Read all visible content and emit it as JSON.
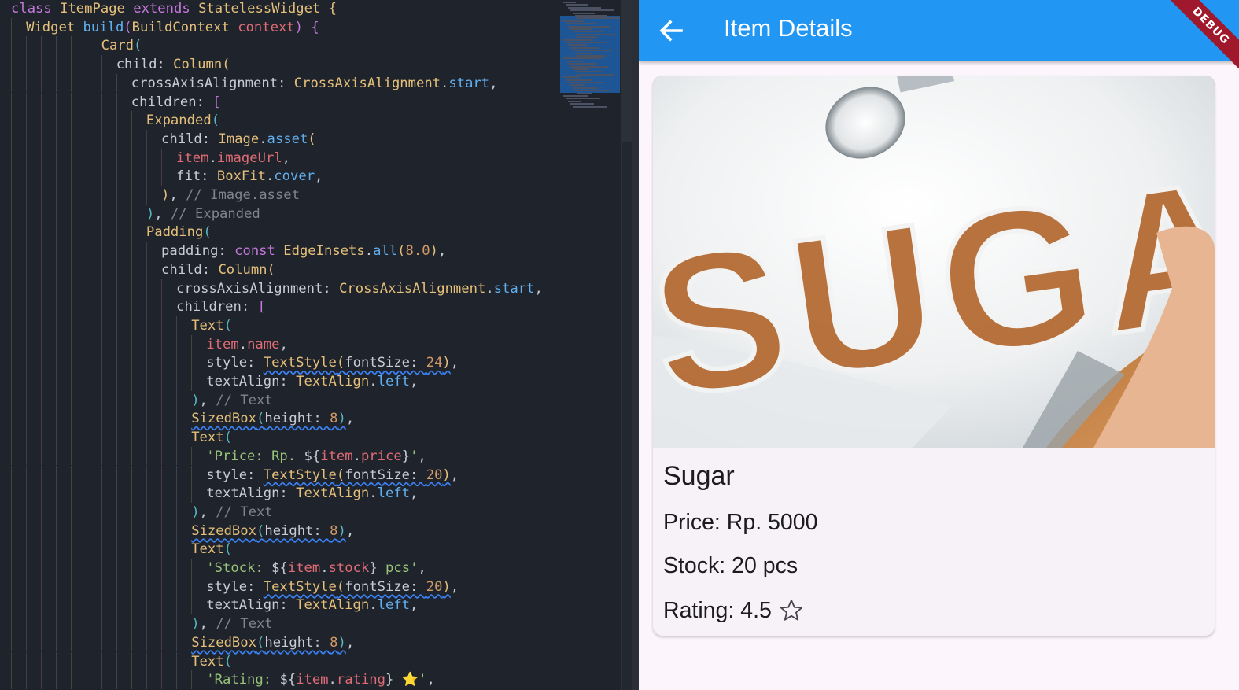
{
  "editor": {
    "lines": [
      {
        "indent": 0,
        "html_parts": [
          [
            "k",
            "class"
          ],
          [
            "p",
            " "
          ],
          [
            "t",
            "ItemPage"
          ],
          [
            "p",
            " "
          ],
          [
            "k",
            "extends"
          ],
          [
            "p",
            " "
          ],
          [
            "t",
            "StatelessWidget"
          ],
          [
            "p",
            " "
          ],
          [
            "b1",
            "{"
          ]
        ]
      },
      {
        "indent": 1,
        "html_parts": [
          [
            "t",
            "Widget"
          ],
          [
            "p",
            " "
          ],
          [
            "f",
            "build"
          ],
          [
            "b2",
            "("
          ],
          [
            "t",
            "BuildContext"
          ],
          [
            "p",
            " "
          ],
          [
            "v",
            "context"
          ],
          [
            "b2",
            ")"
          ],
          [
            "p",
            " "
          ],
          [
            "b2",
            "{"
          ]
        ]
      },
      {
        "indent": 6,
        "html_parts": [
          [
            "t",
            "Card"
          ],
          [
            "b3",
            "("
          ]
        ]
      },
      {
        "indent": 7,
        "html_parts": [
          [
            "p",
            "child: "
          ],
          [
            "t",
            "Column"
          ],
          [
            "b1",
            "("
          ]
        ]
      },
      {
        "indent": 8,
        "html_parts": [
          [
            "p",
            "crossAxisAlignment: "
          ],
          [
            "t",
            "CrossAxisAlignment"
          ],
          [
            "p",
            "."
          ],
          [
            "f",
            "start"
          ],
          [
            "p",
            ","
          ]
        ]
      },
      {
        "indent": 8,
        "html_parts": [
          [
            "p",
            "children: "
          ],
          [
            "b2",
            "["
          ]
        ]
      },
      {
        "indent": 9,
        "html_parts": [
          [
            "t",
            "Expanded"
          ],
          [
            "b3",
            "("
          ]
        ]
      },
      {
        "indent": 10,
        "html_parts": [
          [
            "p",
            "child: "
          ],
          [
            "t",
            "Image"
          ],
          [
            "p",
            "."
          ],
          [
            "f",
            "asset"
          ],
          [
            "b1",
            "("
          ]
        ]
      },
      {
        "indent": 11,
        "html_parts": [
          [
            "v",
            "item"
          ],
          [
            "p",
            "."
          ],
          [
            "v",
            "imageUrl"
          ],
          [
            "p",
            ","
          ]
        ]
      },
      {
        "indent": 11,
        "html_parts": [
          [
            "p",
            "fit: "
          ],
          [
            "t",
            "BoxFit"
          ],
          [
            "p",
            "."
          ],
          [
            "f",
            "cover"
          ],
          [
            "p",
            ","
          ]
        ]
      },
      {
        "indent": 10,
        "html_parts": [
          [
            "b1",
            ")"
          ],
          [
            "p",
            ", "
          ],
          [
            "c",
            "// Image.asset"
          ]
        ]
      },
      {
        "indent": 9,
        "html_parts": [
          [
            "b3",
            ")"
          ],
          [
            "p",
            ", "
          ],
          [
            "c",
            "// Expanded"
          ]
        ]
      },
      {
        "indent": 9,
        "html_parts": [
          [
            "t",
            "Padding"
          ],
          [
            "b3",
            "("
          ]
        ]
      },
      {
        "indent": 10,
        "html_parts": [
          [
            "p",
            "padding: "
          ],
          [
            "k",
            "const"
          ],
          [
            "p",
            " "
          ],
          [
            "t",
            "EdgeInsets"
          ],
          [
            "p",
            "."
          ],
          [
            "f",
            "all"
          ],
          [
            "b1",
            "("
          ],
          [
            "n",
            "8.0"
          ],
          [
            "b1",
            ")"
          ],
          [
            "p",
            ","
          ]
        ]
      },
      {
        "indent": 10,
        "html_parts": [
          [
            "p",
            "child: "
          ],
          [
            "t",
            "Column"
          ],
          [
            "b1",
            "("
          ]
        ]
      },
      {
        "indent": 11,
        "html_parts": [
          [
            "p",
            "crossAxisAlignment: "
          ],
          [
            "t",
            "CrossAxisAlignment"
          ],
          [
            "p",
            "."
          ],
          [
            "f",
            "start"
          ],
          [
            "p",
            ","
          ]
        ]
      },
      {
        "indent": 11,
        "html_parts": [
          [
            "p",
            "children: "
          ],
          [
            "b2",
            "["
          ]
        ]
      },
      {
        "indent": 12,
        "html_parts": [
          [
            "t",
            "Text"
          ],
          [
            "b3",
            "("
          ]
        ]
      },
      {
        "indent": 13,
        "html_parts": [
          [
            "v",
            "item"
          ],
          [
            "p",
            "."
          ],
          [
            "v",
            "name"
          ],
          [
            "p",
            ","
          ]
        ]
      },
      {
        "indent": 13,
        "html_parts": [
          [
            "p",
            "style: "
          ],
          [
            "t wavy",
            "TextStyle"
          ],
          [
            "b1 wavy",
            "("
          ],
          [
            "p wavy",
            "fontSize: "
          ],
          [
            "n wavy",
            "24"
          ],
          [
            "b1 wavy",
            ")"
          ],
          [
            "p",
            ","
          ]
        ]
      },
      {
        "indent": 13,
        "html_parts": [
          [
            "p",
            "textAlign: "
          ],
          [
            "t",
            "TextAlign"
          ],
          [
            "p",
            "."
          ],
          [
            "f",
            "left"
          ],
          [
            "p",
            ","
          ]
        ]
      },
      {
        "indent": 12,
        "html_parts": [
          [
            "b3",
            ")"
          ],
          [
            "p",
            ", "
          ],
          [
            "c",
            "// Text"
          ]
        ]
      },
      {
        "indent": 12,
        "html_parts": [
          [
            "t wavy",
            "SizedBox"
          ],
          [
            "b3 wavy",
            "("
          ],
          [
            "p wavy",
            "height: "
          ],
          [
            "n wavy",
            "8"
          ],
          [
            "b3 wavy",
            ")"
          ],
          [
            "p",
            ","
          ]
        ]
      },
      {
        "indent": 12,
        "html_parts": [
          [
            "t",
            "Text"
          ],
          [
            "b3",
            "("
          ]
        ]
      },
      {
        "indent": 13,
        "html_parts": [
          [
            "s",
            "'Price: Rp. "
          ],
          [
            "p",
            "${"
          ],
          [
            "v",
            "item"
          ],
          [
            "p",
            "."
          ],
          [
            "v",
            "price"
          ],
          [
            "p",
            "}"
          ],
          [
            "s",
            "'"
          ],
          [
            "p",
            ","
          ]
        ]
      },
      {
        "indent": 13,
        "html_parts": [
          [
            "p",
            "style: "
          ],
          [
            "t wavy",
            "TextStyle"
          ],
          [
            "b1 wavy",
            "("
          ],
          [
            "p wavy",
            "fontSize: "
          ],
          [
            "n wavy",
            "20"
          ],
          [
            "b1 wavy",
            ")"
          ],
          [
            "p",
            ","
          ]
        ]
      },
      {
        "indent": 13,
        "html_parts": [
          [
            "p",
            "textAlign: "
          ],
          [
            "t",
            "TextAlign"
          ],
          [
            "p",
            "."
          ],
          [
            "f",
            "left"
          ],
          [
            "p",
            ","
          ]
        ]
      },
      {
        "indent": 12,
        "html_parts": [
          [
            "b3",
            ")"
          ],
          [
            "p",
            ", "
          ],
          [
            "c",
            "// Text"
          ]
        ]
      },
      {
        "indent": 12,
        "html_parts": [
          [
            "t wavy",
            "SizedBox"
          ],
          [
            "b3 wavy",
            "("
          ],
          [
            "p wavy",
            "height: "
          ],
          [
            "n wavy",
            "8"
          ],
          [
            "b3 wavy",
            ")"
          ],
          [
            "p",
            ","
          ]
        ]
      },
      {
        "indent": 12,
        "html_parts": [
          [
            "t",
            "Text"
          ],
          [
            "b3",
            "("
          ]
        ]
      },
      {
        "indent": 13,
        "html_parts": [
          [
            "s",
            "'Stock: "
          ],
          [
            "p",
            "${"
          ],
          [
            "v",
            "item"
          ],
          [
            "p",
            "."
          ],
          [
            "v",
            "stock"
          ],
          [
            "p",
            "}"
          ],
          [
            "s",
            " pcs'"
          ],
          [
            "p",
            ","
          ]
        ]
      },
      {
        "indent": 13,
        "html_parts": [
          [
            "p",
            "style: "
          ],
          [
            "t wavy",
            "TextStyle"
          ],
          [
            "b1 wavy",
            "("
          ],
          [
            "p wavy",
            "fontSize: "
          ],
          [
            "n wavy",
            "20"
          ],
          [
            "b1 wavy",
            ")"
          ],
          [
            "p",
            ","
          ]
        ]
      },
      {
        "indent": 13,
        "html_parts": [
          [
            "p",
            "textAlign: "
          ],
          [
            "t",
            "TextAlign"
          ],
          [
            "p",
            "."
          ],
          [
            "f",
            "left"
          ],
          [
            "p",
            ","
          ]
        ]
      },
      {
        "indent": 12,
        "html_parts": [
          [
            "b3",
            ")"
          ],
          [
            "p",
            ", "
          ],
          [
            "c",
            "// Text"
          ]
        ]
      },
      {
        "indent": 12,
        "html_parts": [
          [
            "t wavy",
            "SizedBox"
          ],
          [
            "b3 wavy",
            "("
          ],
          [
            "p wavy",
            "height: "
          ],
          [
            "n wavy",
            "8"
          ],
          [
            "b3 wavy",
            ")"
          ],
          [
            "p",
            ","
          ]
        ]
      },
      {
        "indent": 12,
        "html_parts": [
          [
            "t",
            "Text"
          ],
          [
            "b3",
            "("
          ]
        ]
      },
      {
        "indent": 13,
        "html_parts": [
          [
            "s",
            "'Rating: "
          ],
          [
            "p",
            "${"
          ],
          [
            "v",
            "item"
          ],
          [
            "p",
            "."
          ],
          [
            "v",
            "rating"
          ],
          [
            "p",
            "}"
          ],
          [
            "s",
            " ⭐'"
          ],
          [
            "p",
            ","
          ]
        ]
      }
    ]
  },
  "app": {
    "title": "Item Details",
    "debug_label": "DEBUG",
    "back_icon": "arrow-back-icon",
    "accent_color": "#2196f3",
    "item": {
      "name": "Sugar",
      "price_text": "Price: Rp. 5000",
      "stock_text": "Stock: 20 pcs",
      "rating_text": "Rating: 4.5",
      "rating_icon": "star-outline-icon",
      "image_caption": "SUGAR"
    }
  }
}
